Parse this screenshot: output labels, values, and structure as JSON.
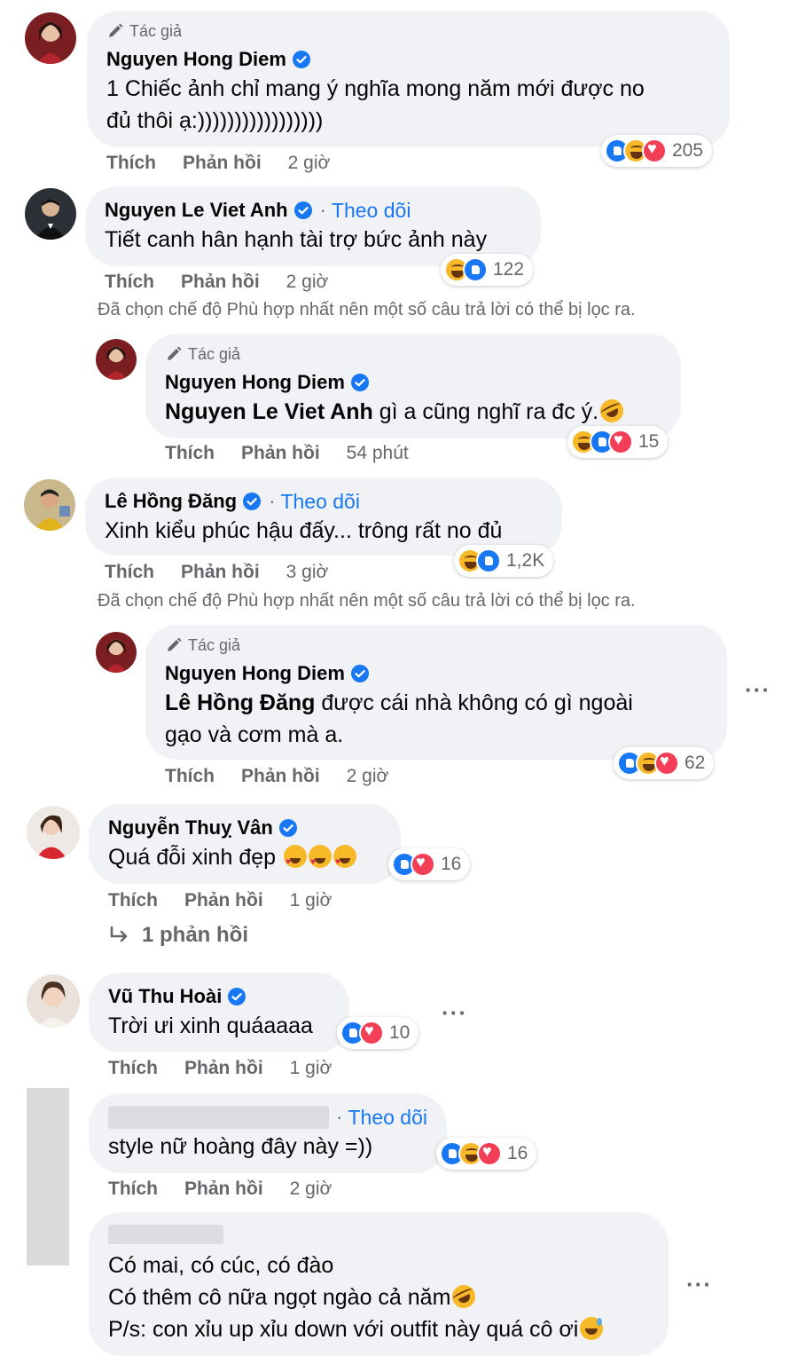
{
  "colors": {
    "bubble": "#f0f2f5",
    "link_blue": "#1877f2",
    "meta_gray": "#65676b",
    "like": "#1877f2",
    "haha": "#f7b928",
    "love": "#f33e58"
  },
  "labels": {
    "author_tag": "Tác giả",
    "like": "Thích",
    "reply": "Phản hồi",
    "follow": "Theo dõi",
    "filter_note": "Đã chọn chế độ Phù hợp nhất nên một số câu trả lời có thể bị lọc ra.",
    "more": "···"
  },
  "comments": [
    {
      "name": "Nguyen Hong Diem",
      "verified": true,
      "is_author": true,
      "text_line1": "1 Chiếc ảnh chỉ mang ý nghĩa mong năm mới được no",
      "text_line2": "đủ thôi ạ:)))))))))))))))))",
      "time": "2 giờ",
      "reactions": [
        "like",
        "haha",
        "love"
      ],
      "reaction_count": "205"
    },
    {
      "name": "Nguyen Le Viet Anh",
      "verified": true,
      "follow": true,
      "text": "Tiết canh hân hạnh tài trợ bức ảnh này",
      "time": "2 giờ",
      "reactions": [
        "haha",
        "like"
      ],
      "reaction_count": "122"
    },
    {
      "name": "Nguyen Hong Diem",
      "verified": true,
      "is_author": true,
      "mention": "Nguyen Le Viet Anh",
      "text": " gì a cũng nghĩ ra đc ý.",
      "emoji": "rofl-icon",
      "time": "54 phút",
      "reactions": [
        "haha",
        "like",
        "love"
      ],
      "reaction_count": "15"
    },
    {
      "name": "Lê Hồng Đăng",
      "verified": true,
      "follow": true,
      "text": "Xinh kiểu phúc hậu đấy... trông rất no đủ",
      "time": "3 giờ",
      "reactions": [
        "haha",
        "like"
      ],
      "reaction_count": "1,2K"
    },
    {
      "name": "Nguyen Hong Diem",
      "verified": true,
      "is_author": true,
      "mention": "Lê Hồng Đăng",
      "text_line1": " được cái nhà không có gì ngoài",
      "text_line2": "gạo và cơm mà a.",
      "time": "2 giờ",
      "reactions": [
        "like",
        "haha",
        "love"
      ],
      "reaction_count": "62"
    },
    {
      "name": "Nguyễn Thuỵ Vân",
      "verified": true,
      "text": "Quá đỗi xinh đẹp ",
      "emoji": "heart-eyes-icon",
      "time": "1 giờ",
      "reactions": [
        "like",
        "love"
      ],
      "reaction_count": "16",
      "replies_label": "1 phản hồi"
    },
    {
      "name": "Vũ Thu Hoài",
      "verified": true,
      "text": "Trời ưi xinh quáaaaa",
      "time": "1 giờ",
      "reactions": [
        "like",
        "love"
      ],
      "reaction_count": "10"
    },
    {
      "name_hidden": true,
      "follow": true,
      "text": "style nữ hoàng đây này =))",
      "time": "2 giờ",
      "reactions": [
        "like",
        "haha",
        "love"
      ],
      "reaction_count": "16"
    },
    {
      "name_hidden": true,
      "line1": "Có mai, có cúc, có đào",
      "line2": "Có thêm cô nữa ngọt ngào cả năm",
      "line3": "P/s: con xỉu up xỉu down với outfit này quá cô ơi",
      "emoji_line2": "rofl-icon",
      "emoji_line3": "sweat-smile-icon"
    }
  ]
}
